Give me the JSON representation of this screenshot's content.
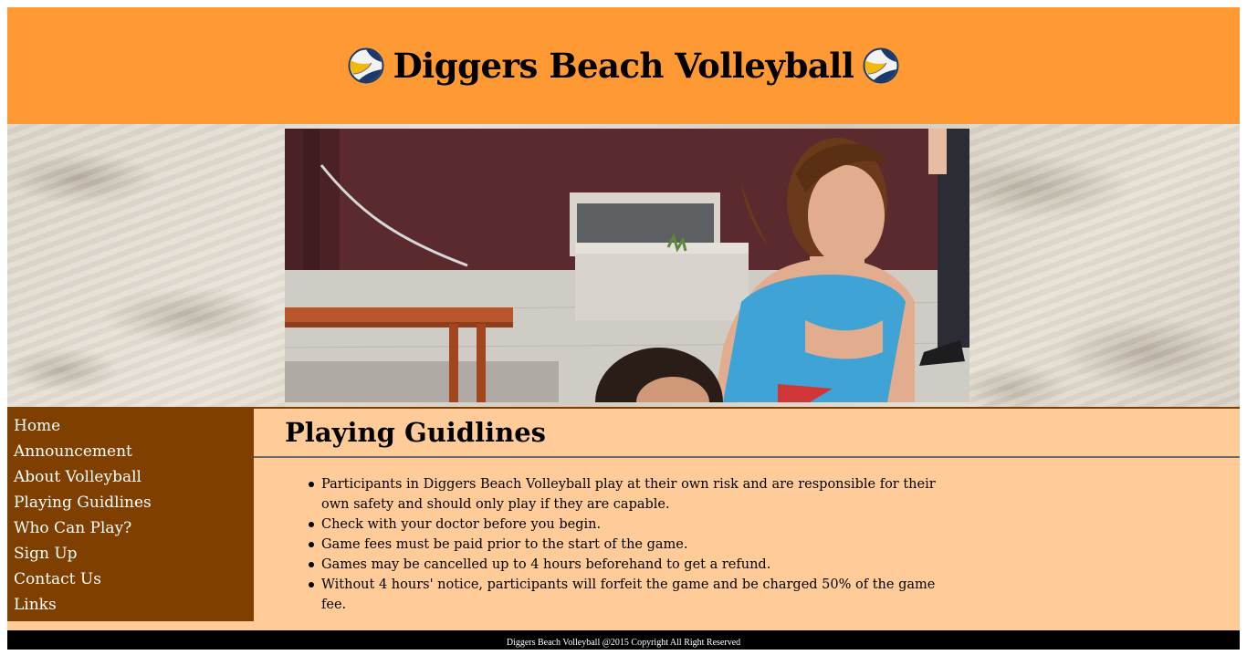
{
  "header": {
    "title": "Diggers Beach Volleyball",
    "logo_icon": "volleyball-icon"
  },
  "colors": {
    "header_bg": "#ff9933",
    "sidebar_bg": "#7f3f00",
    "content_bg": "#ffcc99",
    "footer_bg": "#000000"
  },
  "nav": {
    "items": [
      {
        "label": "Home"
      },
      {
        "label": "Announcement"
      },
      {
        "label": "About Volleyball"
      },
      {
        "label": "Playing Guidlines"
      },
      {
        "label": "Who Can Play?"
      },
      {
        "label": "Sign Up"
      },
      {
        "label": "Contact Us"
      },
      {
        "label": "Links"
      }
    ]
  },
  "main": {
    "title": "Playing Guidlines",
    "guidelines": [
      "Participants in Diggers Beach Volleyball play at their own risk and are responsible for their own safety and should only play if they are capable.",
      "Check with your doctor before you begin.",
      "Game fees must be paid prior to the start of the game.",
      "Games may be cancelled up to 4 hours beforehand to get a refund.",
      "Without 4 hours' notice, participants will forfeit the game and be charged 50% of the game fee."
    ]
  },
  "footer": {
    "text": "Diggers Beach Volleyball @2015 Copyright All Right Reserved"
  }
}
